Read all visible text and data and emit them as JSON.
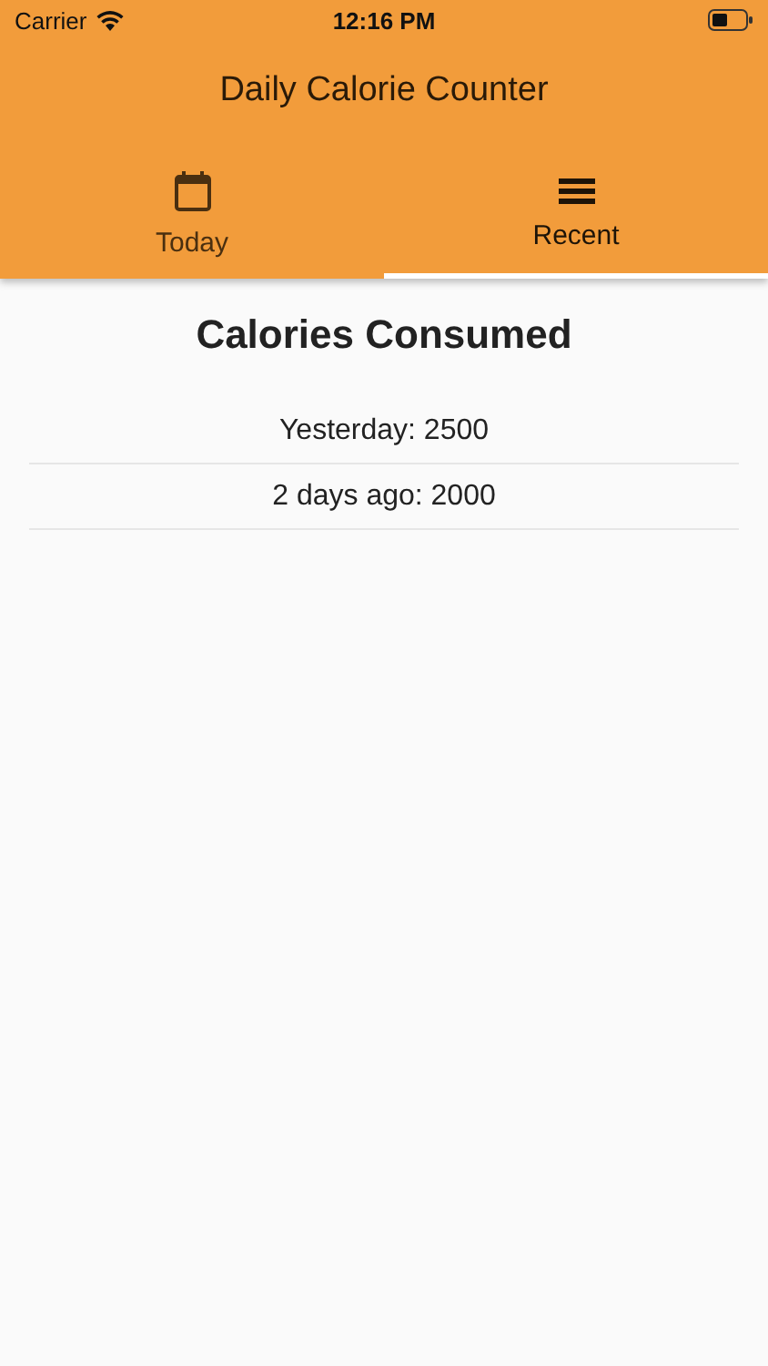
{
  "status_bar": {
    "carrier": "Carrier",
    "time": "12:16 PM"
  },
  "header": {
    "title": "Daily Calorie Counter"
  },
  "tabs": [
    {
      "label": "Today",
      "kind": "calendar",
      "selected": false
    },
    {
      "label": "Recent",
      "kind": "list",
      "selected": true
    }
  ],
  "content": {
    "heading": "Calories Consumed",
    "rows": [
      "Yesterday: 2500",
      "2 days ago: 2000"
    ]
  }
}
